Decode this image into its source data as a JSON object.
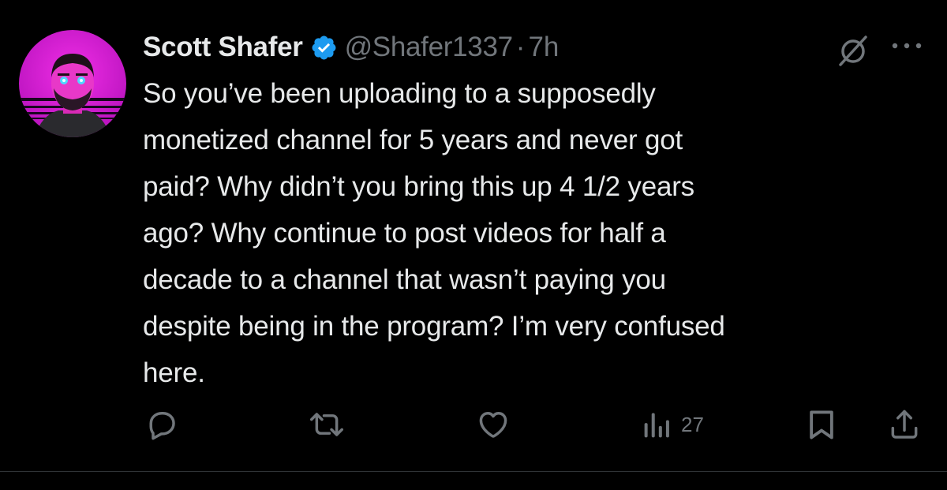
{
  "tweet": {
    "display_name": "Scott Shafer",
    "handle": "@Shafer1337",
    "separator": "·",
    "time": "7h",
    "verified": true,
    "text": "So you’ve been uploading to a supposedly\nmonetized channel for 5 years and never got\npaid? Why didn’t you bring this up 4 1/2 years\nago? Why continue to post videos for half a\ndecade to a channel that wasn’t paying you\ndespite being in the program? I’m very confused\nhere."
  },
  "actions": {
    "reply_icon": "reply-icon",
    "retweet_icon": "retweet-icon",
    "like_icon": "heart-icon",
    "views_icon": "views-icon",
    "views_count": "27",
    "bookmark_icon": "bookmark-icon",
    "share_icon": "share-icon"
  },
  "colors": {
    "background": "#000000",
    "text_primary": "#e7e9ea",
    "text_secondary": "#71767b",
    "verified_blue": "#1d9bf0",
    "avatar_pink": "#d21ad6"
  }
}
